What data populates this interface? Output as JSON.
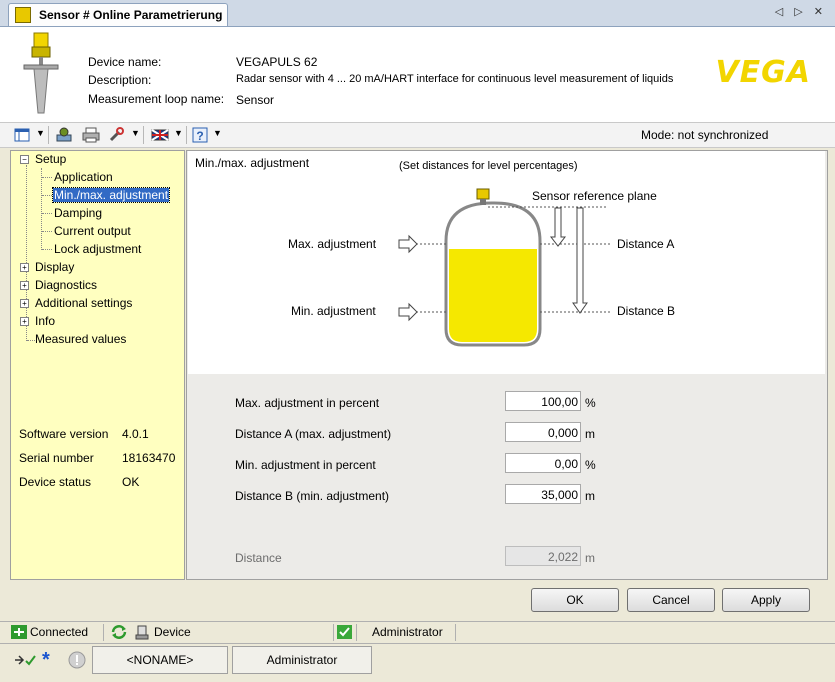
{
  "window": {
    "tab_title": "Sensor # Online Parametrierung",
    "nav_arrows": "◁ ▷ ✕"
  },
  "device": {
    "name_label": "Device name:",
    "name_value": "VEGAPULS 62",
    "description_label": "Description:",
    "description_value": "Radar sensor with 4 ... 20 mA/HART interface for continuous level measurement of liquids",
    "loop_label": "Measurement loop name:",
    "loop_value": "Sensor",
    "logo": "VEGA"
  },
  "toolbar": {
    "mode": "Mode: not synchronized",
    "icons": [
      "view-icon",
      "device-icon",
      "print-icon",
      "tools-icon",
      "language-flag-icon",
      "help-icon"
    ]
  },
  "tree": {
    "setup": "Setup",
    "application": "Application",
    "minmax": "Min./max. adjustment",
    "damping": "Damping",
    "current_output": "Current output",
    "lock_adjustment": "Lock adjustment",
    "display": "Display",
    "diagnostics": "Diagnostics",
    "additional_settings": "Additional settings",
    "info": "Info",
    "measured_values": "Measured values"
  },
  "info": {
    "software_version_label": "Software version",
    "software_version_value": "4.0.1",
    "serial_number_label": "Serial number",
    "serial_number_value": "18163470",
    "device_status_label": "Device status",
    "device_status_value": "OK"
  },
  "panel": {
    "title": "Min./max. adjustment",
    "subtitle": "(Set distances for level percentages)",
    "sensor_reference_plane": "Sensor reference plane",
    "max_adjustment": "Max. adjustment",
    "min_adjustment": "Min. adjustment",
    "distance_a": "Distance A",
    "distance_b": "Distance B",
    "liquid_color": "#f5e800"
  },
  "fields": {
    "max_percent_label": "Max. adjustment in percent",
    "max_percent_value": "100,00",
    "max_percent_unit": "%",
    "distance_a_label": "Distance A (max. adjustment)",
    "distance_a_value": "0,000",
    "distance_a_unit": "m",
    "min_percent_label": "Min. adjustment in percent",
    "min_percent_value": "0,00",
    "min_percent_unit": "%",
    "distance_b_label": "Distance B (min. adjustment)",
    "distance_b_value": "35,000",
    "distance_b_unit": "m",
    "distance_label": "Distance",
    "distance_value": "2,022",
    "distance_unit": "m"
  },
  "buttons": {
    "ok": "OK",
    "cancel": "Cancel",
    "apply": "Apply"
  },
  "status": {
    "connected": "Connected",
    "device": "Device",
    "admin": "Administrator",
    "noname": "<NONAME>",
    "admin2": "Administrator"
  }
}
